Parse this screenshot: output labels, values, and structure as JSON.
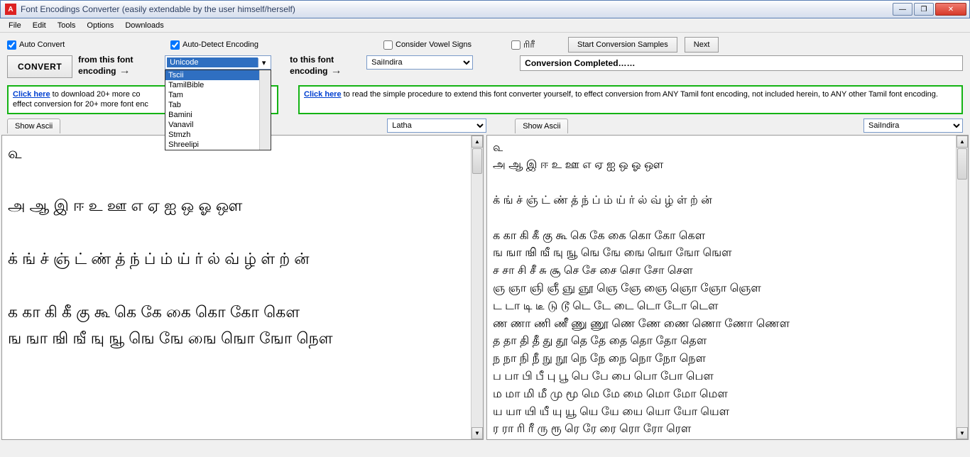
{
  "window": {
    "title": "Font Encodings Converter (easily extendable by the user himself/herself)"
  },
  "menu": [
    "File",
    "Edit",
    "Tools",
    "Options",
    "Downloads"
  ],
  "checks": {
    "auto_convert": "Auto Convert",
    "auto_detect": "Auto-Detect Encoding",
    "vowel_signs": "Consider Vowel Signs",
    "sample_tamil": "ரிரீ"
  },
  "buttons": {
    "convert": "CONVERT",
    "start_samples": "Start Conversion Samples",
    "next": "Next",
    "show_ascii": "Show Ascii"
  },
  "labels": {
    "from": "from this font encoding",
    "to": "to this font encoding"
  },
  "from_select": {
    "value": "Unicode",
    "options": [
      "Tscii",
      "TamilBible",
      "Tam",
      "Tab",
      "Bamini",
      "Vanavil",
      "Stmzh",
      "Shreelipi"
    ]
  },
  "to_select": {
    "value": "SaiIndira"
  },
  "status": "Conversion Completed……",
  "info_left": {
    "link": "Click here",
    "text1": " to download 20+ more co",
    "text2": "effect conversion for 20+ more font enc"
  },
  "info_right": {
    "link": "Click here",
    "text": " to read the simple procedure to extend this font converter yourself, to effect conversion from ANY Tamil font encoding, not included herein, to ANY other Tamil font encoding."
  },
  "font_left": "Latha",
  "font_right": "SaiIndira",
  "left_text": "௳\n\nஅ ஆ இ ஈ உ ஊ எ ஏ ஐ ஒ ஓ ஔ\n\nக் ங் ச் ஞ் ட் ண் த் ந் ப் ம் ய் ர் ல் வ் ழ் ள் ற் ன்\n\nக கா கி கீ கு கூ கெ கே கை கொ கோ கௌ\nங ஙா ஙி ஙீ ஙு ஙூ ஙெ ஙே ஙை ஙொ ஙோ நௌ",
  "right_text": "௳\nஅ ஆ இ ஈ உ ஊ எ ஏ ஐ ஒ ஓ ஔ\n\nக் ங் ச் ஞ் ட் ண் த் ந் ப் ம் ய் ர் ல் வ் ழ் ள் ற் ன்\n\nக கா கி கீ கு கூ கெ கே கை கொ கோ கௌ\nங ஙா ஙி ஙீ ஙு ஙூ ஙெ ஙே ஙை ஙொ ஙோ ஙௌ\nச சா சி சீ சு சூ செ சே சை சொ சோ சௌ\nஞ ஞா ஞி ஞீ ஞு ஞூ ஞெ ஞே ஞை ஞொ ஞோ ஞௌ\nட டா டி டீ டு டூ டெ டே டை டொ டோ டௌ\nண ணா ணி ணீ ணு ணூ ணெ ணே ணை ணொ ணோ ணௌ\nத தா தி தீ து தூ தெ தே தை தொ தோ தௌ\nந நா நி நீ நு நூ நெ நே நை நொ நோ நௌ\nப பா பி பீ பு பூ பெ பே பை பொ போ பௌ\nம மா மி மீ மு மூ மெ மே மை மொ மோ மௌ\nய யா யி யீ யு யூ யெ யே யை யொ யோ யௌ\nர ரா ரி ரீ ரு ரூ ரெ ரே ரை ரொ ரோ ரௌ"
}
